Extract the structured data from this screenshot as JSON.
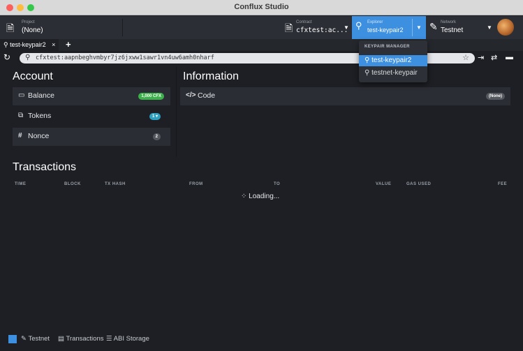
{
  "window": {
    "title": "Conflux Studio"
  },
  "toolbar": {
    "project": {
      "sub_label": "Project",
      "value": "(None)"
    },
    "contract": {
      "sub_label": "Contract",
      "value": "cfxtest:ac..."
    },
    "explorer": {
      "sub_label": "Explorer",
      "value": "test-keypair2"
    },
    "network": {
      "sub_label": "Network",
      "value": "Testnet"
    }
  },
  "tabs": [
    {
      "label": "test-keypair2",
      "close": "×"
    }
  ],
  "tab_add": "+",
  "address": {
    "value": "cfxtest:aapnbeghvmbyr7jz6jxww1sawr1vn4uw6amh0nharf"
  },
  "dropdown": {
    "header": "KEYPAIR MANAGER",
    "items": [
      {
        "label": "test-keypair2",
        "active": true
      },
      {
        "label": "testnet-keypair",
        "active": false
      }
    ]
  },
  "account": {
    "title": "Account",
    "rows": [
      {
        "label": "Balance",
        "badge": "1,000 CFX"
      },
      {
        "label": "Tokens",
        "badge": "1 ▾"
      },
      {
        "label": "Nonce",
        "badge": "2"
      }
    ]
  },
  "information": {
    "title": "Information",
    "rows": [
      {
        "label": "Code",
        "badge": "(None)"
      }
    ]
  },
  "transactions": {
    "title": "Transactions",
    "columns": [
      "TIME",
      "BLOCK",
      "TX HASH",
      "FROM",
      "TO",
      "VALUE",
      "GAS USED",
      "FEE"
    ],
    "loading": "Loading..."
  },
  "statusbar": {
    "items": [
      {
        "label": "Testnet"
      },
      {
        "label": "Transactions"
      },
      {
        "label": "ABI Storage"
      }
    ]
  },
  "colors": {
    "accent": "#3d8fe0",
    "balance_badge": "#3cb04a",
    "tokens_badge": "#2fa0c0"
  }
}
